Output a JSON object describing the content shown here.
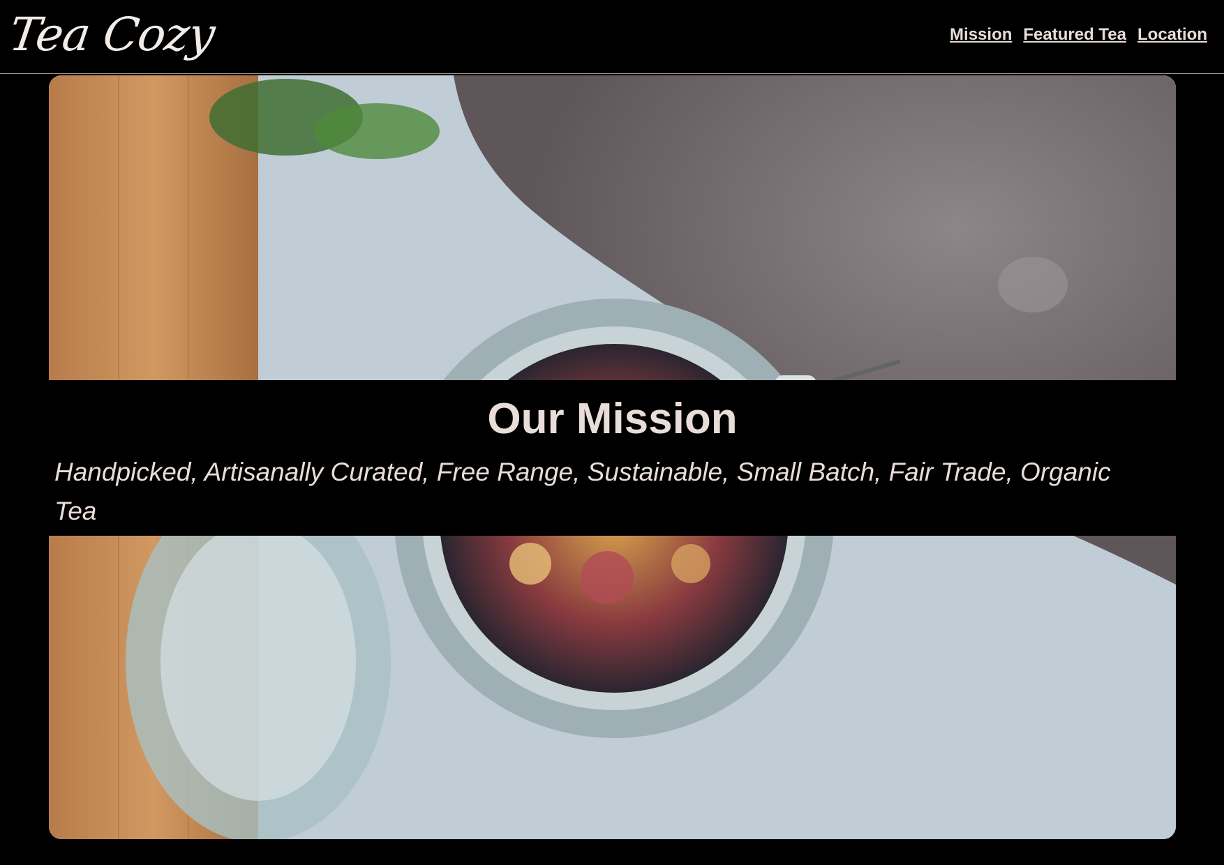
{
  "header": {
    "logo_text": "Tea Cozy",
    "nav": [
      {
        "label": "Mission"
      },
      {
        "label": "Featured Tea"
      },
      {
        "label": "Location"
      }
    ]
  },
  "hero": {
    "image_subject": "tea-jar-photo",
    "title": "Our Mission",
    "text": "Handpicked, Artisanally Curated, Free Range, Sustainable, Small Batch, Fair Trade, Organic Tea"
  },
  "colors": {
    "background": "#000000",
    "text": "#e8ddd8",
    "divider": "#9a9a9a"
  }
}
